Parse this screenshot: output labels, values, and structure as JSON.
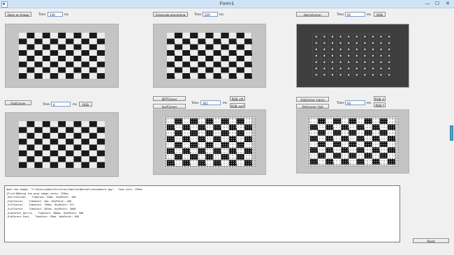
{
  "window": {
    "title": "Form1",
    "minimize": "—",
    "maximize": "☐",
    "close": "✕"
  },
  "row1": {
    "open_image": {
      "button": "Open an image",
      "time_label": "Time:",
      "time_value": "139",
      "unit": "ms"
    },
    "grayscale": {
      "button": "Grayscale processing",
      "time_label": "Time:",
      "time_value": "229",
      "unit": "ms"
    },
    "harris": {
      "button": "HarrisCorner",
      "time_label": "Time:",
      "time_value": "65",
      "unit": "ms",
      "rgb_button": "RGB"
    }
  },
  "row2": {
    "fast": {
      "button": "FastCorner",
      "time_label": "Time:",
      "time_value": "4",
      "unit": "ms",
      "rgb_button": "RGB"
    },
    "sift_surf": {
      "sift_button": "SIFTCorner",
      "surf_button": "SurfCorner",
      "time_label": "Time:",
      "time_value": "361",
      "unit": "ms",
      "rgb_sift": "RGB_sift",
      "rgb_surf": "RGB_surf"
    },
    "orb": {
      "harris_button": "OrbCorner_harris",
      "fast_button": "OrbCorner_fast",
      "time_label": "Time:",
      "time_value": "93",
      "unit": "ms",
      "rgb_h": "RGB_h",
      "rgb_f": "RGB_f"
    }
  },
  "log": {
    "lines": [
      "Open the image: \"C:\\Users\\admin\\Pictures\\Zoglink\\Wechat\\chessboard.jpg\".  Time cost: 139ms",
      "[First]Making the gray image costs: 229ms.",
      "_HarrisCorner_   TimeCost: 65ms. KeyPoint: 100",
      "_FastCorner_   TimeCost: 4ms. KeyPoint: 460",
      "_SiftCorner_   TimeCost: 730ms. KeyPoint: 571",
      "_SurfCorner_   TimeCost: 361ms. KeyPoint: 2000",
      "_OrbCorner_Harris_   TimeCost: 380ms. KeyPoint: 500",
      "_OrbCorner_Fast_   TimeCost: 93ms. KeyPoint: 500"
    ]
  },
  "reset_button": "Reset",
  "colors": {
    "titlebar": "#cfe3f7",
    "window_bg": "#f0f0f0",
    "harris_bg": "#3e3e3e"
  }
}
